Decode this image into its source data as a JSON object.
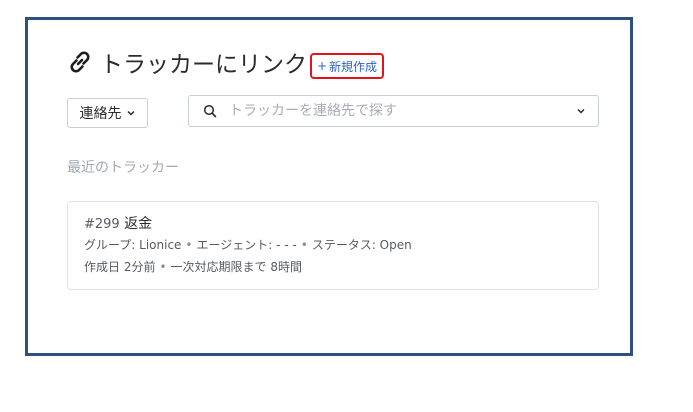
{
  "header": {
    "title": "トラッカーにリンク",
    "create_new_label": "新規作成",
    "create_new_plus": "+"
  },
  "filters": {
    "contact_label": "連絡先",
    "search_placeholder": "トラッカーを連絡先で探す"
  },
  "recent": {
    "label": "最近のトラッカー",
    "tickets": [
      {
        "id": "#299",
        "subject": "返金",
        "group_label": "グループ: Lionice",
        "agent_label": "エージェント: - - -",
        "status_label": "ステータス: Open",
        "created_label": "作成日 2分前",
        "sla_label": "一次対応期限まで 8時間"
      }
    ]
  },
  "colors": {
    "frame_border": "#2f4f7f",
    "highlight_border": "#e0141a",
    "link_blue": "#2b63c6"
  },
  "icons": [
    "link-icon",
    "chevron-down-icon",
    "search-icon"
  ]
}
